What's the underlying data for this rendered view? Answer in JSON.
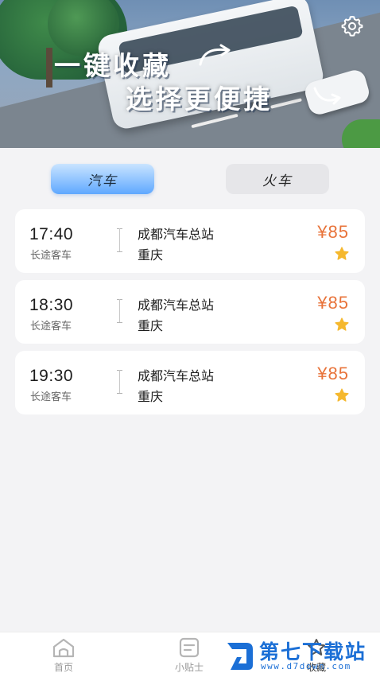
{
  "banner": {
    "line1": "一键收藏",
    "line2": "选择更便捷"
  },
  "tabs": [
    {
      "label": "汽车",
      "active": true
    },
    {
      "label": "火车",
      "active": false
    }
  ],
  "trips": [
    {
      "time": "17:40",
      "type": "长途客车",
      "from": "成都汽车总站",
      "to": "重庆",
      "price": "¥85",
      "favorited": true
    },
    {
      "time": "18:30",
      "type": "长途客车",
      "from": "成都汽车总站",
      "to": "重庆",
      "price": "¥85",
      "favorited": true
    },
    {
      "time": "19:30",
      "type": "长途客车",
      "from": "成都汽车总站",
      "to": "重庆",
      "price": "¥85",
      "favorited": true
    }
  ],
  "bottom_nav": {
    "home": "首页",
    "tips": "小贴士",
    "favorites": "收藏"
  },
  "watermark": {
    "name": "第七下载站",
    "url": "www.d7down.com"
  },
  "colors": {
    "price": "#e8733a",
    "star": "#f5b82e",
    "active_tab": "#5fa8ff",
    "watermark": "#1b6fd6"
  }
}
